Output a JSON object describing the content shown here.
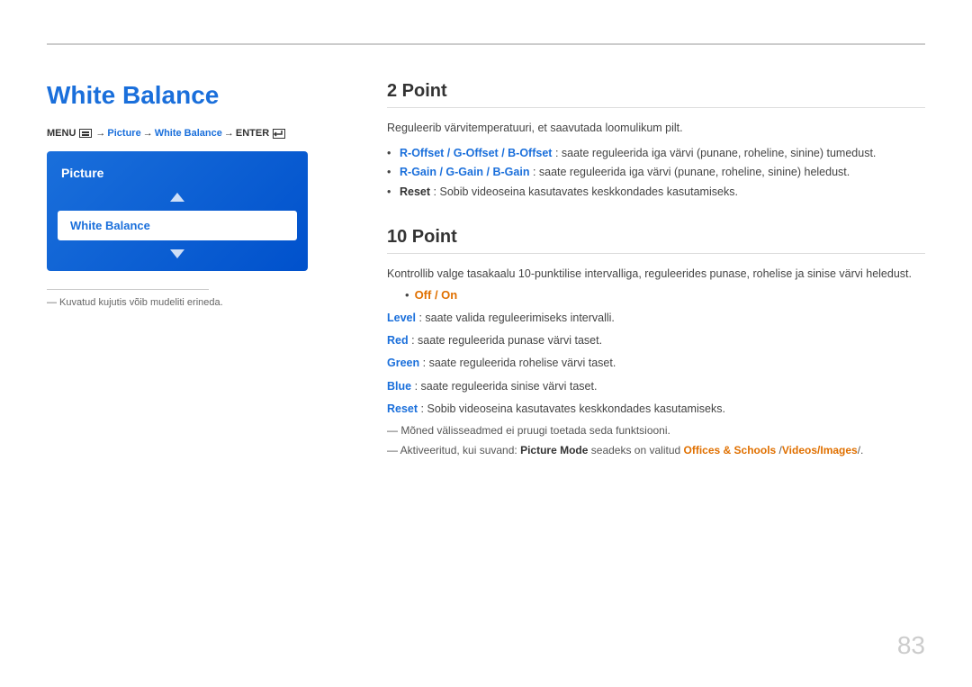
{
  "topLine": {},
  "leftPanel": {
    "title": "White Balance",
    "menuPath": {
      "text": "MENU",
      "arrow1": "→",
      "picture": "Picture",
      "arrow2": "→",
      "whiteBalance": "White Balance",
      "arrow3": "→",
      "enter": "ENTER"
    },
    "pictureBox": {
      "title": "Picture",
      "selectedItem": "White Balance"
    },
    "note": "― Kuvatud kujutis võib mudeliti erineda."
  },
  "rightPanel": {
    "section1": {
      "title": "2 Point",
      "desc": "Reguleerib värvitemperatuuri, et saavutada loomulikum pilt.",
      "bullets": [
        {
          "boldPart": "R-Offset / G-Offset / B-Offset",
          "boldColor": "blue",
          "rest": ": saate reguleerida iga värvi (punane, roheline, sinine) tumedust."
        },
        {
          "boldPart": "R-Gain / G-Gain / B-Gain",
          "boldColor": "blue",
          "rest": ": saate reguleerida iga värvi (punane, roheline, sinine) heledust."
        },
        {
          "boldPart": "Reset",
          "boldColor": "black",
          "rest": ": Sobib videoseina kasutavates keskkondades kasutamiseks."
        }
      ]
    },
    "section2": {
      "title": "10 Point",
      "desc": "Kontrollib valge tasakaalu 10-punktilise intervalliga, reguleerides punase, rohelise ja sinise värvi heledust.",
      "subBullet": "Off / On",
      "fields": [
        {
          "boldPart": "Level",
          "boldColor": "blue",
          "rest": ": saate valida reguleerimiseks intervalli."
        },
        {
          "boldPart": "Red",
          "boldColor": "blue",
          "rest": ": saate reguleerida punase värvi taset."
        },
        {
          "boldPart": "Green",
          "boldColor": "blue",
          "rest": ": saate reguleerida rohelise värvi taset."
        },
        {
          "boldPart": "Blue",
          "boldColor": "blue",
          "rest": ": saate reguleerida sinise värvi taset."
        },
        {
          "boldPart": "Reset",
          "boldColor": "blue",
          "rest": ": Sobib videoseina kasutavates keskkondades kasutamiseks."
        }
      ],
      "notes": [
        "― Mõned välisseadmed ei pruugi toetada seda funktsiooni.",
        "― Aktiveeritud, kui suvand: Picture Mode seadeks on valitud Offices & Schools /Videos/Images/."
      ]
    }
  },
  "pageNumber": "83"
}
